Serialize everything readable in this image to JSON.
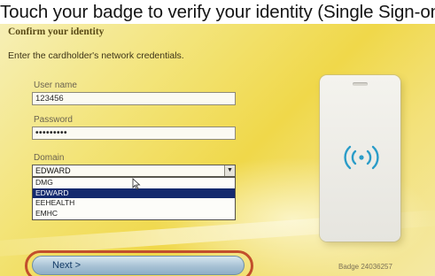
{
  "caption": "Touch your badge to verify your identity (Single Sign-on) one more time. If it's telling you to confirm your identity, type in your network credentials (username and password, instead of Badge ID and PIN). Click Next, and you are ready to use Imprivata. TIP: Use your badge to log in each time you will be signing on.",
  "dialog": {
    "title": "Confirm your identity",
    "instruction": "Enter the cardholder's network credentials."
  },
  "form": {
    "username": {
      "label": "User name",
      "value": "123456"
    },
    "password": {
      "label": "Password",
      "value": "•••••••••"
    },
    "domain": {
      "label": "Domain",
      "value": "EDWARD",
      "options": [
        "DMG",
        "EDWARD",
        "EEHEALTH",
        "EMHC"
      ],
      "selected": "EDWARD"
    }
  },
  "next_button": {
    "label": "Next >"
  },
  "badge_text": "Badge 24036257",
  "colors": {
    "background": "#f1dd5c",
    "selection": "#142a6e",
    "highlight_ring": "#c24f2c",
    "button": "#a7c1d4",
    "nfc_icon": "#2a9cc8"
  },
  "icons": {
    "contactless": "contactless-icon",
    "cursor": "mouse-cursor-icon",
    "dropdown": "chevron-down-icon"
  }
}
